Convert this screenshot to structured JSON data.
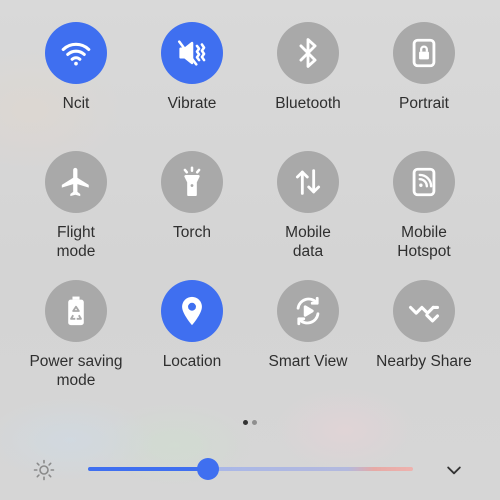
{
  "colors": {
    "active": "#3f6ff0",
    "inactive": "#a9a9a9",
    "icon": "#ffffff"
  },
  "tiles": [
    {
      "label": "Ncit",
      "icon": "wifi-icon",
      "active": true
    },
    {
      "label": "Vibrate",
      "icon": "vibrate-icon",
      "active": true
    },
    {
      "label": "Bluetooth",
      "icon": "bluetooth-icon",
      "active": false
    },
    {
      "label": "Portrait",
      "icon": "portrait-lock-icon",
      "active": false
    },
    {
      "label": "Flight\nmode",
      "icon": "airplane-icon",
      "active": false
    },
    {
      "label": "Torch",
      "icon": "flashlight-icon",
      "active": false
    },
    {
      "label": "Mobile\ndata",
      "icon": "mobile-data-icon",
      "active": false
    },
    {
      "label": "Mobile\nHotspot",
      "icon": "hotspot-icon",
      "active": false
    },
    {
      "label": "Power saving\nmode",
      "icon": "battery-saver-icon",
      "active": false
    },
    {
      "label": "Location",
      "icon": "location-icon",
      "active": true
    },
    {
      "label": "Smart View",
      "icon": "smart-view-icon",
      "active": false
    },
    {
      "label": "Nearby Share",
      "icon": "nearby-share-icon",
      "active": false
    }
  ],
  "pagination": {
    "pages": 2,
    "current": 1
  },
  "brightness": {
    "icon": "brightness-icon",
    "level": 0.37
  },
  "expand": {
    "icon": "chevron-down-icon"
  }
}
